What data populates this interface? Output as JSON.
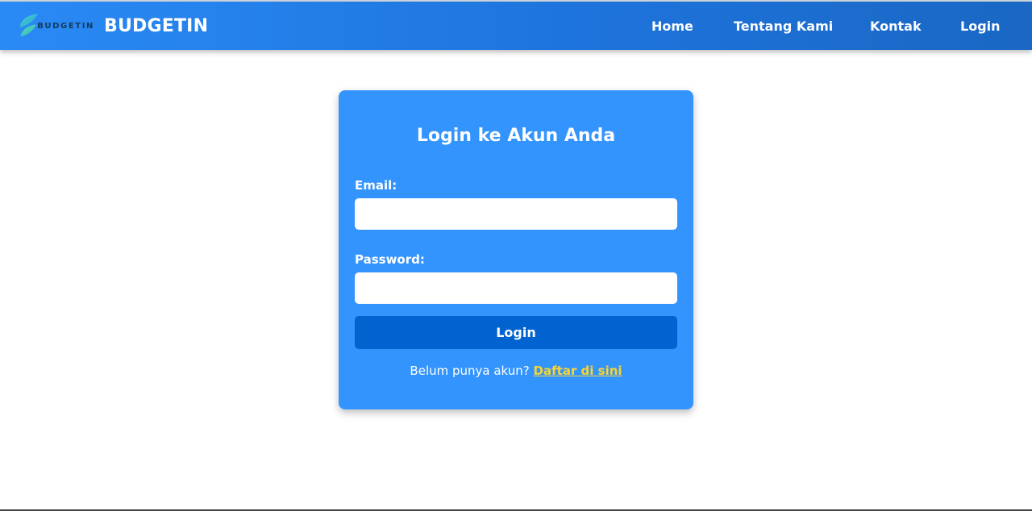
{
  "navbar": {
    "logo_text": "BUDGETIN",
    "brand_title": "BUDGETIN",
    "links": [
      {
        "label": "Home"
      },
      {
        "label": "Tentang Kami"
      },
      {
        "label": "Kontak"
      },
      {
        "label": "Login"
      }
    ],
    "colors": {
      "start": "#2a8af5",
      "end": "#1a67c4"
    }
  },
  "login_card": {
    "title": "Login ke Akun Anda",
    "email_label": "Email:",
    "email_value": "",
    "password_label": "Password:",
    "password_value": "",
    "submit_label": "Login",
    "signup_prompt": "Belum punya akun?",
    "signup_link": "Daftar di sini",
    "colors": {
      "card": "#3394fd",
      "button": "#0163d0",
      "link": "#f8d531"
    }
  }
}
